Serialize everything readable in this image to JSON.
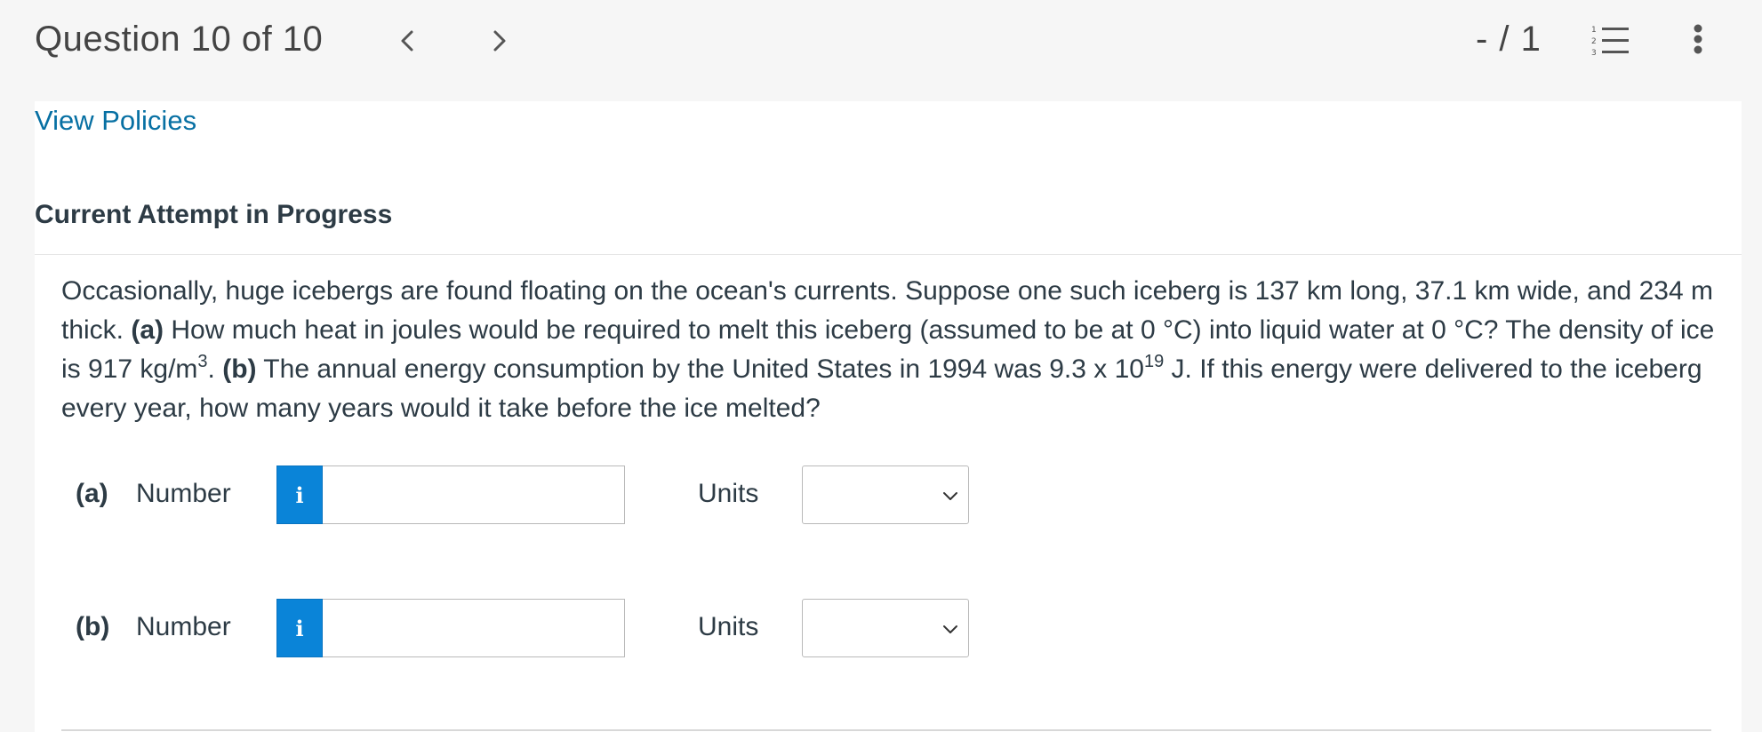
{
  "header": {
    "question_counter": "Question 10 of 10",
    "score": "- / 1",
    "prev_icon": "chevron-left-icon",
    "next_icon": "chevron-right-icon",
    "list_icon": "numbered-list-icon",
    "more_icon": "more-vertical-icon"
  },
  "main": {
    "policies_link": "View Policies",
    "attempt_heading": "Current Attempt in Progress",
    "question": {
      "intro": "Occasionally, huge icebergs are found floating on the ocean's currents. Suppose one such iceberg is 137 km long, 37.1 km wide, and 234 m thick. ",
      "part_a_marker": "(a)",
      "part_a_text": " How much heat in joules would be required to melt this iceberg (assumed to be at 0 °C) into liquid water at 0 °C? The density of ice is 917 kg/m",
      "density_exponent": "3",
      "after_density": ". ",
      "part_b_marker": "(b)",
      "part_b_text": " The annual energy consumption by the United States in 1994 was 9.3 x 10",
      "energy_exponent": "19",
      "closing_text": " J. If this energy were delivered to the iceberg every year, how many years would it take before the ice melted?"
    },
    "answers": [
      {
        "part": "(a)",
        "number_label": "Number",
        "info_glyph": "i",
        "number_value": "",
        "units_label": "Units",
        "units_selected": ""
      },
      {
        "part": "(b)",
        "number_label": "Number",
        "info_glyph": "i",
        "number_value": "",
        "units_label": "Units",
        "units_selected": ""
      }
    ]
  },
  "colors": {
    "link": "#0770a3",
    "info_button": "#0a84d8",
    "text": "#2d3b45",
    "background": "#f6f6f6"
  }
}
